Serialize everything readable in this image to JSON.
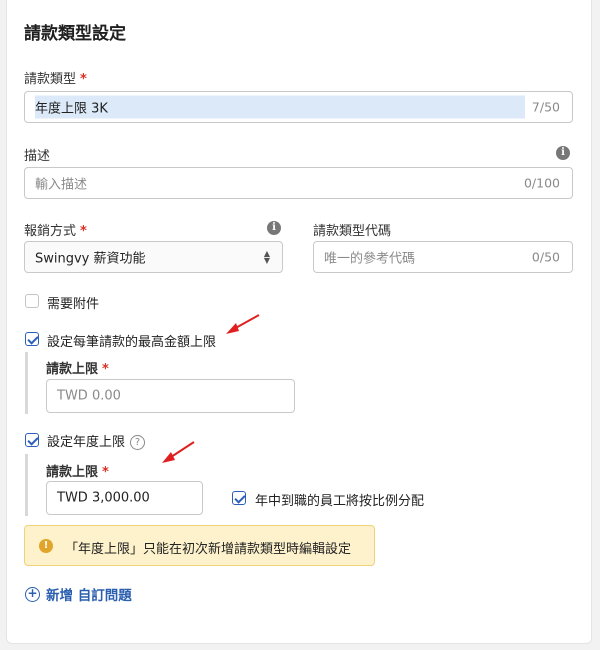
{
  "form": {
    "title": "請款類型設定",
    "claim_type": {
      "label": "請款類型",
      "value": "年度上限 3K",
      "counter": "7/50"
    },
    "description": {
      "label": "描述",
      "placeholder": "輸入描述",
      "counter": "0/100"
    },
    "reimbursement": {
      "label": "報銷方式",
      "value": "Swingvy 薪資功能"
    },
    "type_code": {
      "label": "請款類型代碼",
      "placeholder": "唯一的參考代碼",
      "counter": "0/50"
    },
    "require_attachment": {
      "label": "需要附件",
      "checked": false
    },
    "per_claim_limit": {
      "label": "設定每筆請款的最高金額上限",
      "checked": true,
      "sub_label": "請款上限",
      "placeholder": "TWD 0.00"
    },
    "annual_limit": {
      "label": "設定年度上限",
      "checked": true,
      "sub_label": "請款上限",
      "value": "TWD 3,000.00",
      "prorate_label": "年中到職的員工將按比例分配",
      "prorate_checked": true
    },
    "notice": "「年度上限」只能在初次新增請款類型時編輯設定",
    "add_question": "新增 自訂問題"
  },
  "colors": {
    "accent": "#2c5fb8",
    "required": "#d93025",
    "notice_bg": "#fdf2cc",
    "arrow": "#e02020"
  }
}
